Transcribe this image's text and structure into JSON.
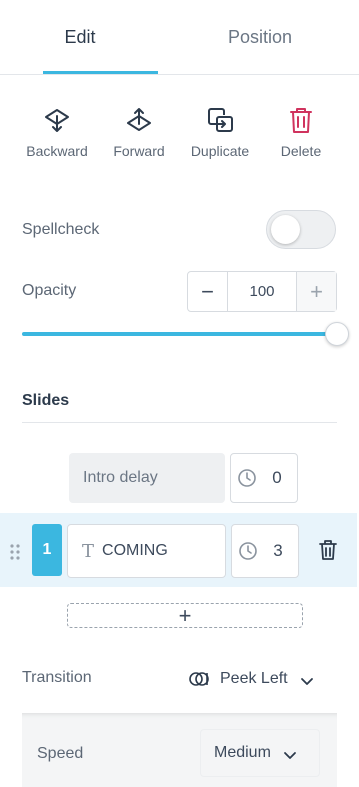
{
  "tabs": [
    {
      "label": "Edit",
      "active": true
    },
    {
      "label": "Position",
      "active": false
    }
  ],
  "actions": {
    "backward": {
      "label": "Backward",
      "icon": "send-backward-icon"
    },
    "forward": {
      "label": "Forward",
      "icon": "bring-forward-icon"
    },
    "duplicate": {
      "label": "Duplicate",
      "icon": "duplicate-icon"
    },
    "delete": {
      "label": "Delete",
      "icon": "trash-icon"
    }
  },
  "spellcheck": {
    "label": "Spellcheck",
    "enabled": false
  },
  "opacity": {
    "label": "Opacity",
    "value": "100",
    "minus": "−",
    "plus": "+",
    "slider_percent": 100
  },
  "slides": {
    "title": "Slides",
    "intro": {
      "label": "Intro delay",
      "delay": "0"
    },
    "items": [
      {
        "number": "1",
        "text": "COMING",
        "delay": "3"
      }
    ],
    "add_label": "+"
  },
  "transition": {
    "label": "Transition",
    "value": "Peek Left"
  },
  "speed": {
    "label": "Speed",
    "value": "Medium"
  },
  "colors": {
    "accent": "#3bb7e0",
    "delete": "#d0335e",
    "text": "#3d4a5c"
  }
}
